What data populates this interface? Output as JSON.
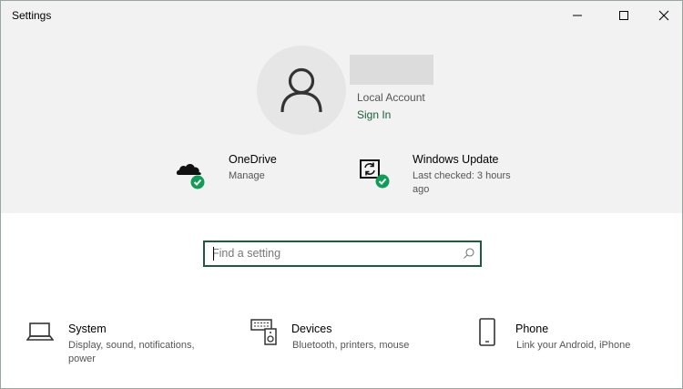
{
  "window": {
    "title": "Settings"
  },
  "account": {
    "type_label": "Local Account",
    "sign_in_label": "Sign In"
  },
  "tiles": {
    "onedrive": {
      "title": "OneDrive",
      "subtitle": "Manage",
      "icon": "onedrive-icon"
    },
    "windows_update": {
      "title": "Windows Update",
      "subtitle_line1": "Last checked: 3 hours",
      "subtitle_line2": "ago",
      "icon": "windows-update-icon"
    }
  },
  "search": {
    "placeholder": "Find a setting",
    "value": ""
  },
  "categories": [
    {
      "title": "System",
      "desc_line1": "Display, sound, notifications,",
      "desc_line2": "power",
      "icon": "laptop-icon"
    },
    {
      "title": "Devices",
      "desc_line1": "Bluetooth, printers, mouse",
      "icon": "devices-icon"
    },
    {
      "title": "Phone",
      "desc_line1": "Link your Android, iPhone",
      "icon": "phone-icon"
    }
  ],
  "colors": {
    "accent": "#1e5a3f",
    "check_green": "#0f9d58",
    "header_bg": "#f2f2f2"
  }
}
